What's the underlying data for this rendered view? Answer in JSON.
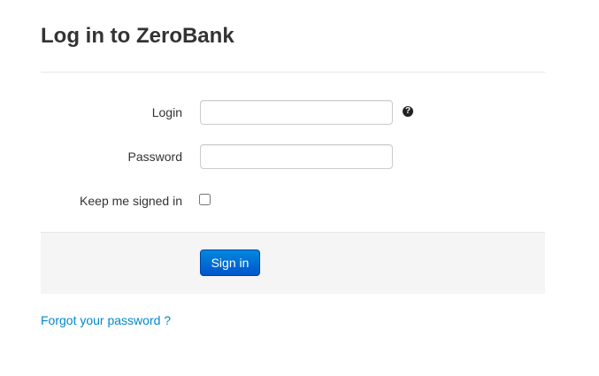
{
  "page": {
    "title": "Log in to ZeroBank"
  },
  "form": {
    "login_label": "Login",
    "login_value": "",
    "help_icon": "question-circle-icon",
    "help_glyph": "?",
    "password_label": "Password",
    "password_value": "",
    "keep_signed_in_label": "Keep me signed in",
    "keep_signed_in_checked": false,
    "signin_label": "Sign in"
  },
  "links": {
    "forgot_password": "Forgot your password ?"
  },
  "colors": {
    "link": "#0088cc",
    "button": "#0066cc",
    "actions_background": "#f5f5f5"
  }
}
